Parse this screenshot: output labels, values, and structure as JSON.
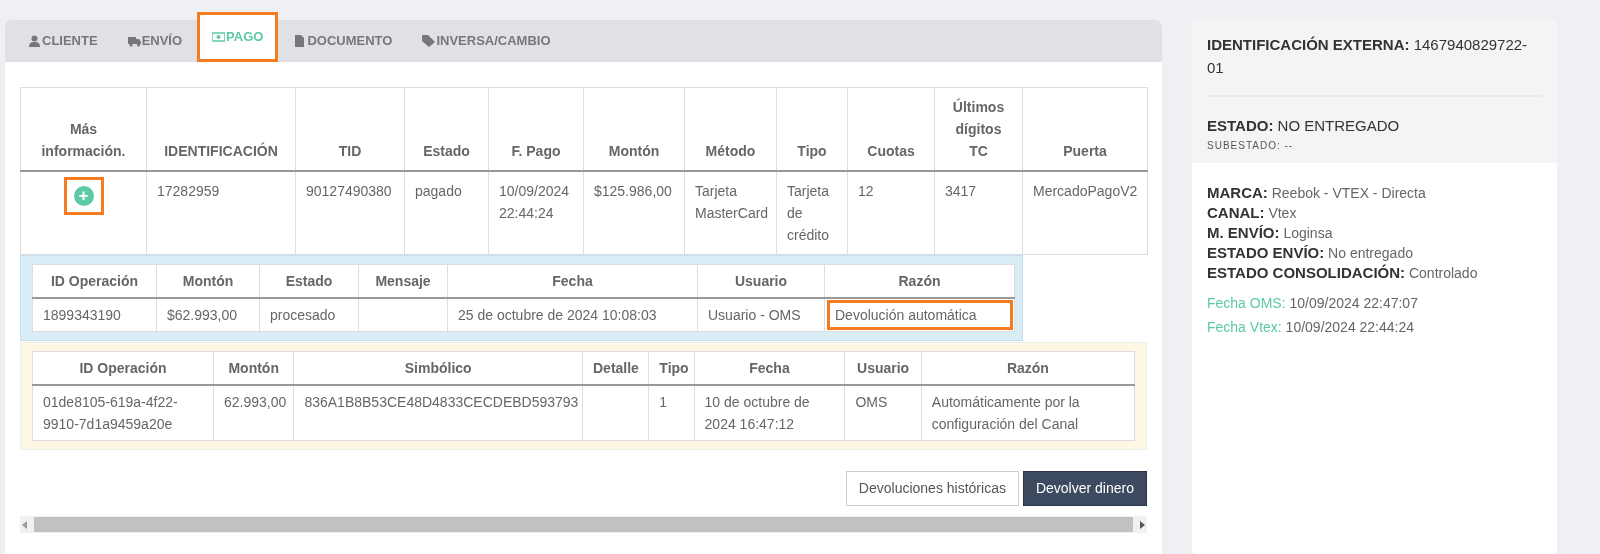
{
  "tabs": [
    {
      "label": "CLIENTE",
      "selected": false,
      "highlighted": false
    },
    {
      "label": "ENVÍO",
      "selected": false,
      "highlighted": false
    },
    {
      "label": "PAGO",
      "selected": true,
      "highlighted": true
    },
    {
      "label": "DOCUMENTO",
      "selected": false,
      "highlighted": false
    },
    {
      "label": "INVERSA/CAMBIO",
      "selected": false,
      "highlighted": false
    }
  ],
  "payments_table": {
    "columns": [
      "Más información.",
      "IDENTIFICACIÓN",
      "TID",
      "Estado",
      "F. Pago",
      "Montón",
      "Método",
      "Tipo",
      "Cuotas",
      "Últimos dígitos TC",
      "Puerta"
    ],
    "rows": [
      {
        "more_info_highlighted": true,
        "cells": [
          "+",
          "17282959",
          "90127490380",
          "pagado",
          "10/09/2024 22:44:24",
          "$125.986,00",
          "Tarjeta MasterCard",
          "Tarjeta de crédito",
          "12",
          "3417",
          "MercadoPagoV2"
        ]
      }
    ]
  },
  "operations_table": {
    "columns": [
      "ID Operación",
      "Montón",
      "Estado",
      "Mensaje",
      "Fecha",
      "Usuario",
      "Razón"
    ],
    "rows": [
      {
        "cells": [
          {
            "text": "1899343190",
            "highlighted": false
          },
          {
            "text": "$62.993,00",
            "highlighted": false
          },
          {
            "text": "procesado",
            "highlighted": false
          },
          {
            "text": "",
            "highlighted": false
          },
          {
            "text": "25 de octubre de 2024 10:08:03",
            "highlighted": false
          },
          {
            "text": "Usuario - OMS",
            "highlighted": false
          },
          {
            "text": "Devolución automática",
            "highlighted": true
          }
        ]
      }
    ]
  },
  "refunds_table": {
    "columns": [
      "ID Operación",
      "Montón",
      "Simbólico",
      "Detalle",
      "Tipo",
      "Fecha",
      "Usuario",
      "Razón"
    ],
    "rows": [
      {
        "cells": [
          "01de8105-619a-4f22-9910-7d1a9459a20e",
          "62.993,00",
          "836A1B8B53CE48D4833CECDEBD593793",
          "",
          "1",
          "10 de octubre de 2024 16:47:12",
          "OMS",
          "Automáticamente por la configuración del Canal"
        ]
      }
    ]
  },
  "buttons": [
    {
      "label": "Devoluciones históricas",
      "kind": "outline"
    },
    {
      "label": "Devolver dinero",
      "kind": "dark"
    }
  ],
  "summary": {
    "external_id": {
      "label": "IDENTIFICACIÓN EXTERNA:",
      "value": "1467940829722-01"
    },
    "status": {
      "label": "ESTADO:",
      "value": "NO ENTREGADO"
    },
    "substatus": {
      "label": "SUBESTADO:",
      "value": "--"
    },
    "details": [
      {
        "label": "MARCA:",
        "value": "Reebok - VTEX - Directa"
      },
      {
        "label": "CANAL:",
        "value": "Vtex"
      },
      {
        "label": "M. ENVÍO:",
        "value": "Loginsa"
      },
      {
        "label": "ESTADO ENVÍO:",
        "value": "No entregado"
      },
      {
        "label": "ESTADO CONSOLIDACIÓN:",
        "value": "Controlado"
      }
    ],
    "dates": [
      {
        "label": "Fecha OMS:",
        "value": "10/09/2024 22:47:07"
      },
      {
        "label": "Fecha Vtex:",
        "value": "10/09/2024 22:44:24"
      }
    ]
  }
}
